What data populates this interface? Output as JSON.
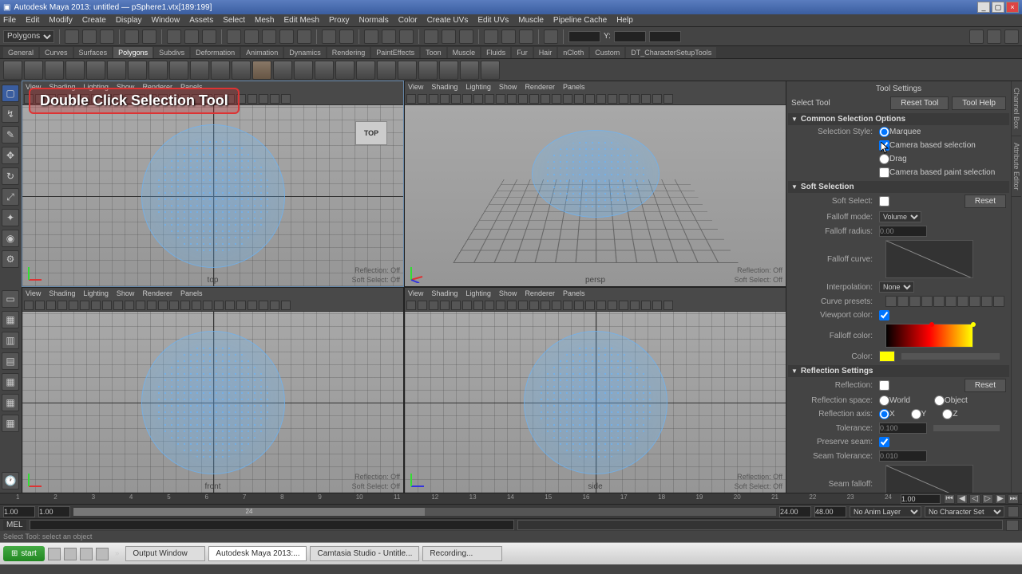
{
  "title": "Autodesk Maya 2013: untitled — pSphere1.vtx[189:199]",
  "menus": [
    "File",
    "Edit",
    "Modify",
    "Create",
    "Display",
    "Window",
    "Assets",
    "Select",
    "Mesh",
    "Edit Mesh",
    "Proxy",
    "Normals",
    "Color",
    "Create UVs",
    "Edit UVs",
    "Muscle",
    "Pipeline Cache",
    "Help"
  ],
  "module_dropdown": "Polygons",
  "coord_label": "Y:",
  "shelf_tabs": [
    "General",
    "Curves",
    "Surfaces",
    "Polygons",
    "Subdivs",
    "Deformation",
    "Animation",
    "Dynamics",
    "Rendering",
    "PaintEffects",
    "Toon",
    "Muscle",
    "Fluids",
    "Fur",
    "Hair",
    "nCloth",
    "Custom",
    "DT_CharacterSetupTools"
  ],
  "active_shelf_tab": "Polygons",
  "annotation_text": "Double Click Selection Tool",
  "viewports": {
    "menus": [
      "View",
      "Shading",
      "Lighting",
      "Show",
      "Renderer",
      "Panels"
    ],
    "labels": {
      "tl": "top",
      "tr": "persp",
      "bl": "front",
      "br": "side"
    },
    "status": {
      "reflection": "Reflection:",
      "reflection_val": "Off",
      "softselect": "Soft Select:",
      "softselect_val": "Off"
    },
    "top_badge": "TOP"
  },
  "tool_settings": {
    "title": "Tool Settings",
    "tool_name": "Select Tool",
    "reset_btn": "Reset Tool",
    "help_btn": "Tool Help",
    "sections": {
      "common": {
        "title": "Common Selection Options",
        "selection_style_lbl": "Selection Style:",
        "marquee": "Marquee",
        "drag": "Drag",
        "cam_based": "Camera based selection",
        "cam_paint": "Camera based paint selection"
      },
      "soft": {
        "title": "Soft Selection",
        "soft_select_lbl": "Soft Select:",
        "reset_btn": "Reset",
        "falloff_mode_lbl": "Falloff mode:",
        "falloff_mode_val": "Volume",
        "falloff_radius_lbl": "Falloff radius:",
        "falloff_radius_val": "0.00",
        "falloff_curve_lbl": "Falloff curve:",
        "interpolation_lbl": "Interpolation:",
        "interpolation_val": "None",
        "curve_presets_lbl": "Curve presets:",
        "viewport_color_lbl": "Viewport color:",
        "falloff_color_lbl": "Falloff color:",
        "color_lbl": "Color:"
      },
      "reflection": {
        "title": "Reflection Settings",
        "reflection_lbl": "Reflection:",
        "reset_btn": "Reset",
        "space_lbl": "Reflection space:",
        "world": "World",
        "object": "Object",
        "axis_lbl": "Reflection axis:",
        "axis_x": "X",
        "axis_y": "Y",
        "axis_z": "Z",
        "tolerance_lbl": "Tolerance:",
        "tolerance_val": "0.100",
        "preserve_lbl": "Preserve seam:",
        "seam_tol_lbl": "Seam Tolerance:",
        "seam_tol_val": "0.010",
        "seam_falloff_lbl": "Seam falloff:"
      }
    }
  },
  "right_tabs": [
    "Channel Box",
    "Attribute Editor"
  ],
  "timeline": {
    "start": "1",
    "end": "24",
    "ticks": [
      "1",
      "2",
      "3",
      "4",
      "5",
      "6",
      "7",
      "8",
      "9",
      "10",
      "11",
      "12",
      "13",
      "14",
      "15",
      "16",
      "17",
      "18",
      "19",
      "20",
      "21",
      "22",
      "23",
      "24"
    ],
    "range_start": "1.00",
    "range_start_inner": "1.00",
    "range_end_inner": "24.00",
    "range_end": "48.00",
    "current": "1.00",
    "anim_layer": "No Anim Layer",
    "char_set": "No Character Set"
  },
  "command": {
    "prefix": "MEL"
  },
  "help_text": "Select Tool: select an object",
  "taskbar": {
    "start": "start",
    "tasks": [
      "Output Window",
      "Autodesk Maya 2013:...",
      "Camtasia Studio - Untitle...",
      "Recording..."
    ]
  },
  "colors": {
    "yellow": "#ffff00",
    "accent": "#3a5d9f",
    "highlight_red": "#d33333"
  }
}
